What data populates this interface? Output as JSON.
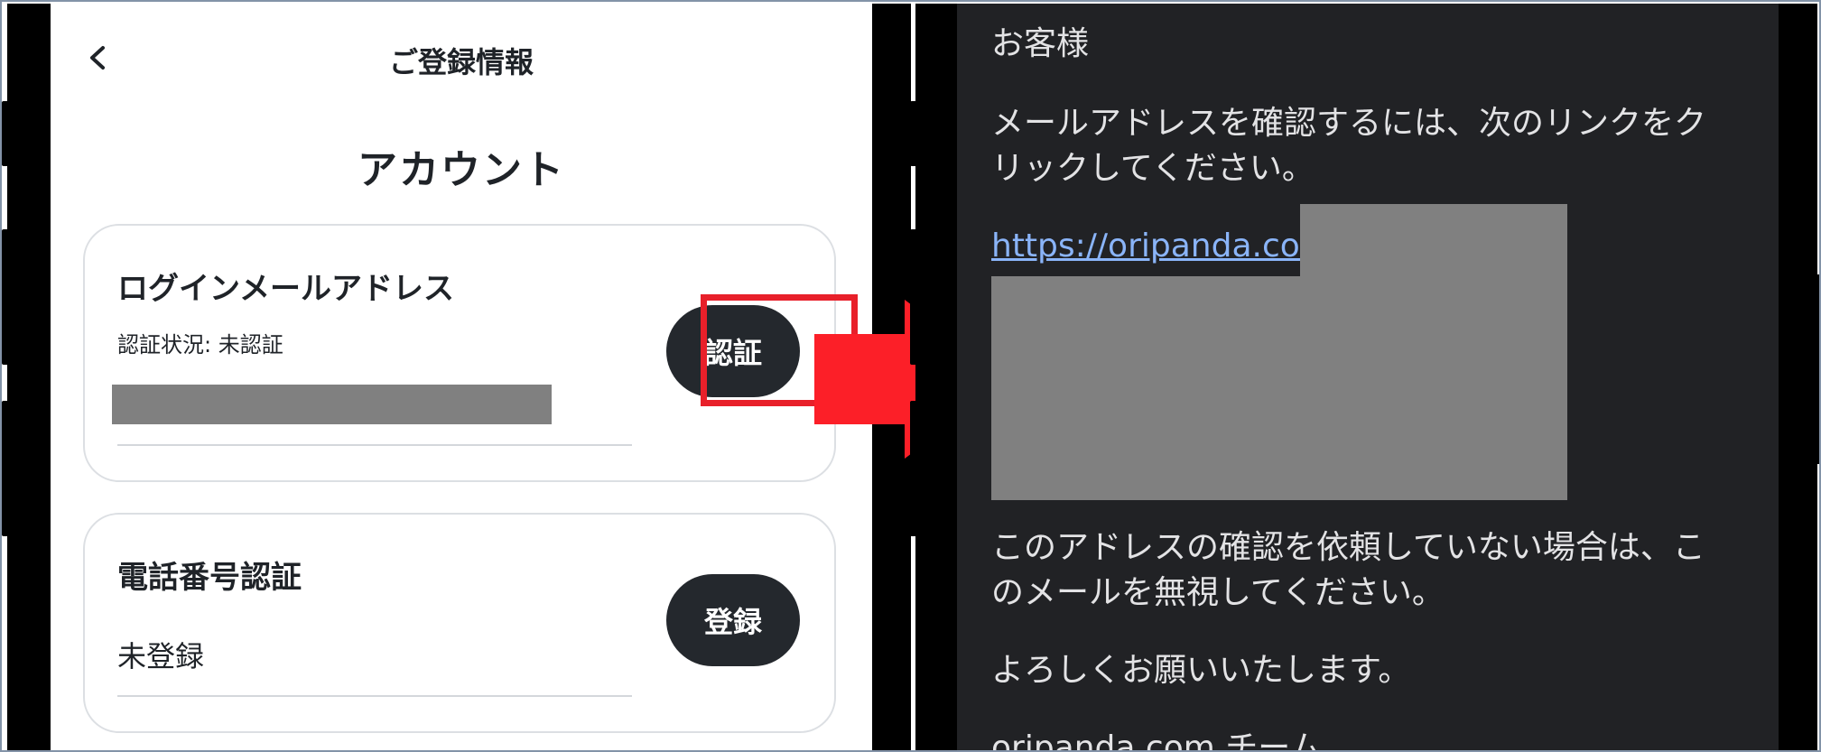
{
  "left_screen": {
    "nav_title": "ご登録情報",
    "section_title": "アカウント",
    "email_card": {
      "title": "ログインメールアドレス",
      "status": "認証状況: 未認証",
      "button_label": "認証"
    },
    "phone_card": {
      "title": "電話番号認証",
      "status": "未登録",
      "button_label": "登録"
    }
  },
  "right_screen": {
    "greeting": "お客様",
    "instruction_line1": "メールアドレスを確認するには、次のリンクをク",
    "instruction_line2": "リックしてください。",
    "link_text": "https://oripanda.com/",
    "ignore_line1": "このアドレスの確認を依頼していない場合は、こ",
    "ignore_line2": "のメールを無視してください。",
    "closing": "よろしくお願いいたします。",
    "signature": "oripanda.com チーム"
  },
  "colors": {
    "highlight": "#e8202a",
    "arrow": "#fc1f28",
    "button_dark": "#24282d",
    "link": "#8ab4f8",
    "mail_background": "#212225"
  }
}
